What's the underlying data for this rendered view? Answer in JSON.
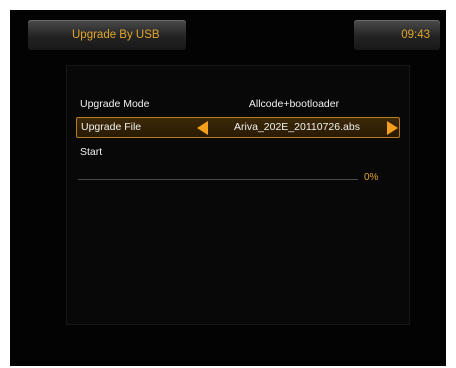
{
  "header": {
    "title": "Upgrade By USB",
    "clock": "09:43"
  },
  "menu": {
    "upgrade_mode": {
      "label": "Upgrade Mode",
      "value": "Allcode+bootloader"
    },
    "upgrade_file": {
      "label": "Upgrade File",
      "value": "Ariva_202E_20110726.abs",
      "left_arrow_icon": "arrow-left-icon",
      "right_arrow_icon": "arrow-right-icon",
      "selected": true
    },
    "start": {
      "label": "Start"
    }
  },
  "progress": {
    "percent": 0,
    "text": "0%"
  },
  "colors": {
    "accent": "#e0a52a",
    "highlight_border": "#b97c1d",
    "arrow": "#f5a01c",
    "text": "#f0f0f0",
    "background": "#030303"
  }
}
